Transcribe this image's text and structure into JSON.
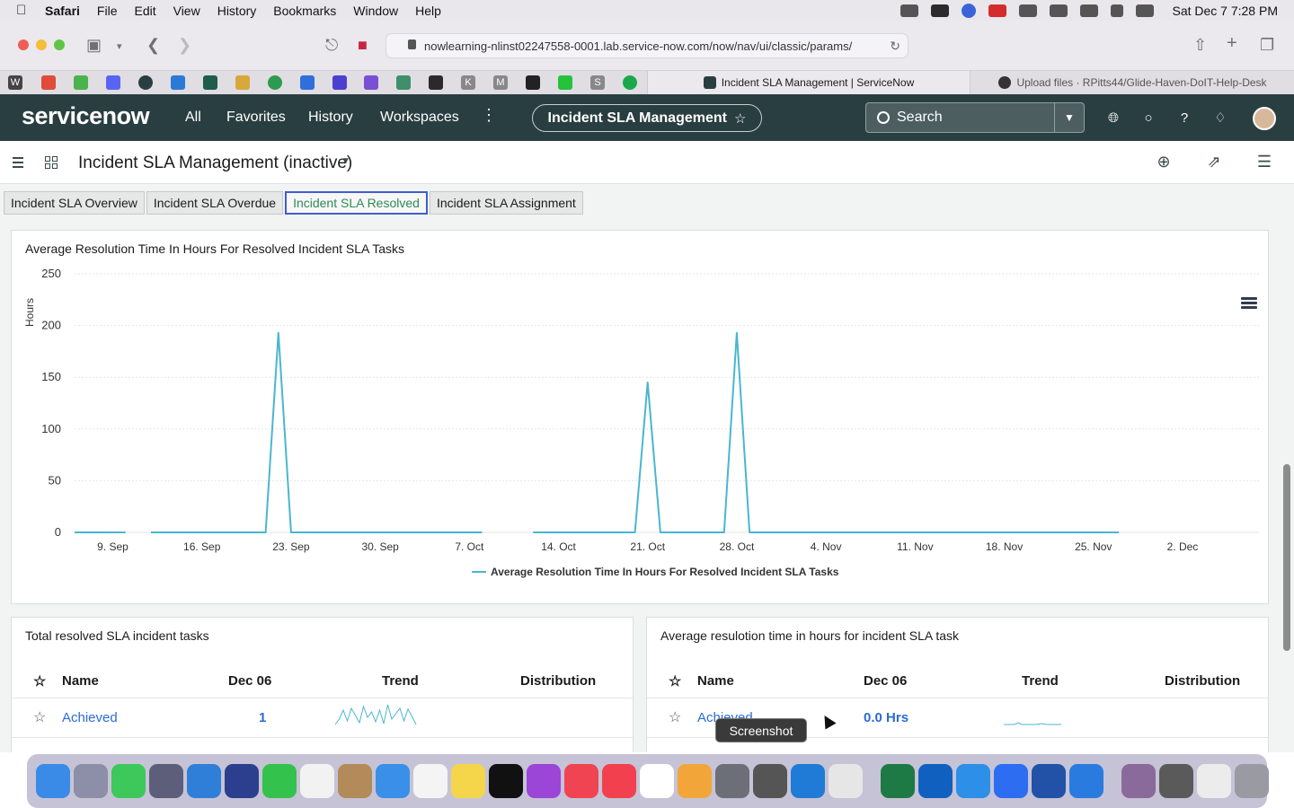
{
  "menubar": {
    "app": "Safari",
    "items": [
      "File",
      "Edit",
      "View",
      "History",
      "Bookmarks",
      "Window",
      "Help"
    ],
    "clock": "Sat Dec 7  7:28 PM"
  },
  "browser": {
    "url": "nowlearning-nlinst02247558-0001.lab.service-now.com/now/nav/ui/classic/params/",
    "tabs": [
      {
        "title": "Incident SLA Management | ServiceNow",
        "active": true
      },
      {
        "title": "Upload files · RPitts44/Glide-Haven-DoIT-Help-Desk",
        "active": false
      }
    ],
    "favorite_letters": [
      "W",
      "M",
      "K",
      "M",
      "S"
    ]
  },
  "sn_header": {
    "logo": "servicenow",
    "nav": [
      "All",
      "Favorites",
      "History",
      "Workspaces"
    ],
    "context_pill": "Incident SLA Management",
    "search_placeholder": "Search"
  },
  "dashboard": {
    "title": "Incident SLA Management (inactive)",
    "tabs": [
      "Incident SLA Overview",
      "Incident SLA Overdue",
      "Incident SLA Resolved",
      "Incident SLA Assignment"
    ],
    "active_tab_index": 2
  },
  "chart_card": {
    "title": "Average Resolution Time In Hours For Resolved Incident SLA Tasks"
  },
  "chart_data": {
    "type": "line",
    "title": "Average Resolution Time In Hours For Resolved Incident SLA Tasks",
    "ylabel": "Hours",
    "ylim": [
      0,
      250
    ],
    "yticks": [
      0,
      50,
      100,
      150,
      200,
      250
    ],
    "xticks": [
      "9. Sep",
      "16. Sep",
      "23. Sep",
      "30. Sep",
      "7. Oct",
      "14. Oct",
      "21. Oct",
      "28. Oct",
      "4. Nov",
      "11. Nov",
      "18. Nov",
      "25. Nov",
      "2. Dec"
    ],
    "series": [
      {
        "name": "Average Resolution Time In Hours For Resolved Incident SLA Tasks",
        "color": "#4ab6d0",
        "segments": [
          [
            [
              "2024-09-06",
              0
            ],
            [
              "2024-09-10",
              0
            ]
          ],
          [
            [
              "2024-09-12",
              0
            ],
            [
              "2024-09-21",
              0
            ],
            [
              "2024-09-22",
              193
            ],
            [
              "2024-09-23",
              0
            ],
            [
              "2024-10-08",
              0
            ]
          ],
          [
            [
              "2024-10-12",
              0
            ],
            [
              "2024-10-20",
              0
            ],
            [
              "2024-10-21",
              145
            ],
            [
              "2024-10-22",
              0
            ],
            [
              "2024-10-27",
              0
            ],
            [
              "2024-10-28",
              193
            ],
            [
              "2024-10-29",
              0
            ],
            [
              "2024-11-27",
              0
            ]
          ]
        ]
      }
    ],
    "x_range": [
      "2024-09-06",
      "2024-12-08"
    ],
    "grid": true,
    "legend": "bottom-center"
  },
  "table_left": {
    "title": "Total resolved SLA incident tasks",
    "columns": [
      "Name",
      "Dec 06",
      "Trend",
      "Distribution"
    ],
    "rows": [
      {
        "name": "Achieved",
        "value": "1"
      }
    ]
  },
  "table_right": {
    "title": "Average resulotion time in hours for incident SLA task",
    "columns": [
      "Name",
      "Dec 06",
      "Trend",
      "Distribution"
    ],
    "rows": [
      {
        "name": "Achieved",
        "value": "0.0 Hrs"
      }
    ]
  },
  "tooltip": "Screenshot",
  "colors": {
    "sn_header": "#293e40",
    "accent_line": "#4ab6d0",
    "link": "#2a6cd6",
    "active_tab_border": "#3d5fd1"
  }
}
